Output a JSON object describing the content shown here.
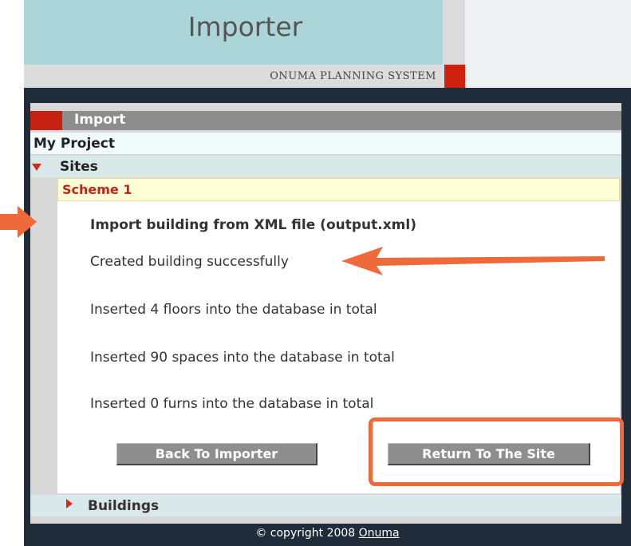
{
  "header": {
    "title": "Importer",
    "system_name": "ONUMA PLANNING SYSTEM"
  },
  "panel": {
    "title": "Import",
    "tree": {
      "project": "My Project",
      "sites": "Sites",
      "scheme": "Scheme 1",
      "buildings": "Buildings"
    }
  },
  "results": {
    "title": "Import building from XML file (output.xml)",
    "messages": [
      "Created building successfully",
      "Inserted 4 floors into the database in total",
      "Inserted 90 spaces into the database in total",
      "Inserted 0 furns into the database in total"
    ]
  },
  "buttons": {
    "back": "Back To Importer",
    "return": "Return To The Site"
  },
  "footer": {
    "copyright": "© copyright 2008 ",
    "link": "Onuma"
  },
  "colors": {
    "header_teal": "#abd5d8",
    "frame_dark": "#202c3a",
    "accent_red": "#c62214",
    "annotation_orange": "#ee6a3b",
    "button_gray": "#8e8e8e"
  },
  "icons": {
    "sites_toggle": "caret-down-icon",
    "buildings_toggle": "caret-right-icon",
    "annotation_arrows": "arrow-icon"
  }
}
